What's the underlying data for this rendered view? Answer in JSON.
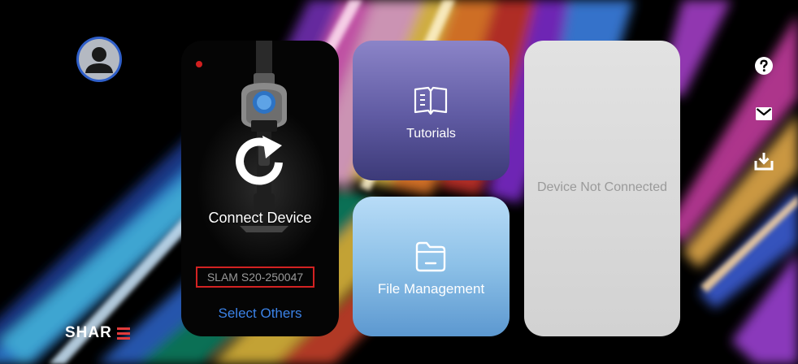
{
  "device_card": {
    "connect_label": "Connect Device",
    "device_name": "SLAM S20-250047",
    "select_others_label": "Select Others",
    "status_dot_color": "#d11f1f",
    "refresh_icon": "refresh-icon"
  },
  "tiles": {
    "tutorials": {
      "label": "Tutorials",
      "icon": "book-icon"
    },
    "file_management": {
      "label": "File Management",
      "icon": "folder-icon"
    }
  },
  "status_panel": {
    "label": "Device Not Connected"
  },
  "side_icons": [
    "help-icon",
    "mail-icon",
    "download-icon"
  ],
  "brand": {
    "text": "SHAR",
    "accent_color": "#e23b3b"
  },
  "colors": {
    "accent_blue": "#3b82e6",
    "highlight_red": "#d32222",
    "tutorials_tile": "#6f69b3",
    "files_tile": "#8cc0e7",
    "status_panel": "#d9d9d9"
  }
}
